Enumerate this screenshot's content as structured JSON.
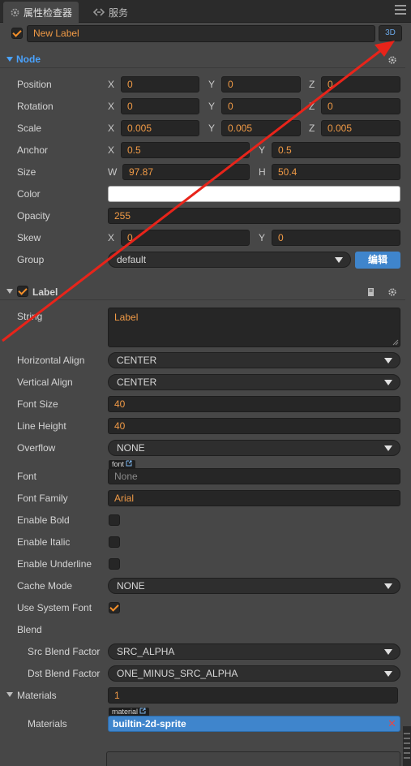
{
  "tabs": [
    {
      "label": "属性检查器",
      "icon": "gear-icon"
    },
    {
      "label": "服务",
      "icon": "link-icon"
    }
  ],
  "node_name": {
    "value": "New Label",
    "toggle": "3D"
  },
  "node_section": {
    "title": "Node",
    "position": {
      "label": "Position",
      "x": "0",
      "y": "0",
      "z": "0"
    },
    "rotation": {
      "label": "Rotation",
      "x": "0",
      "y": "0",
      "z": "0"
    },
    "scale": {
      "label": "Scale",
      "x": "0.005",
      "y": "0.005",
      "z": "0.005"
    },
    "anchor": {
      "label": "Anchor",
      "x": "0.5",
      "y": "0.5"
    },
    "size": {
      "label": "Size",
      "w": "97.87",
      "h": "50.4"
    },
    "color": {
      "label": "Color",
      "value": "#ffffff"
    },
    "opacity": {
      "label": "Opacity",
      "value": "255"
    },
    "skew": {
      "label": "Skew",
      "x": "0",
      "y": "0"
    },
    "group": {
      "label": "Group",
      "value": "default",
      "edit_label": "编辑"
    },
    "axes": {
      "x": "X",
      "y": "Y",
      "z": "Z",
      "w": "W",
      "h": "H"
    }
  },
  "label_section": {
    "title": "Label",
    "string": {
      "label": "String",
      "value": "Label"
    },
    "horizontal_align": {
      "label": "Horizontal Align",
      "value": "CENTER"
    },
    "vertical_align": {
      "label": "Vertical Align",
      "value": "CENTER"
    },
    "font_size": {
      "label": "Font Size",
      "value": "40"
    },
    "line_height": {
      "label": "Line Height",
      "value": "40"
    },
    "overflow": {
      "label": "Overflow",
      "value": "NONE"
    },
    "font": {
      "label": "Font",
      "tag": "font",
      "value": "None"
    },
    "font_family": {
      "label": "Font Family",
      "value": "Arial"
    },
    "enable_bold": {
      "label": "Enable Bold",
      "checked": false
    },
    "enable_italic": {
      "label": "Enable Italic",
      "checked": false
    },
    "enable_underline": {
      "label": "Enable Underline",
      "checked": false
    },
    "cache_mode": {
      "label": "Cache Mode",
      "value": "NONE"
    },
    "use_system_font": {
      "label": "Use System Font",
      "checked": true
    },
    "blend": {
      "label": "Blend"
    },
    "src_blend": {
      "label": "Src Blend Factor",
      "value": "SRC_ALPHA"
    },
    "dst_blend": {
      "label": "Dst Blend Factor",
      "value": "ONE_MINUS_SRC_ALPHA"
    },
    "materials_count": {
      "label": "Materials",
      "value": "1"
    },
    "material": {
      "label": "Materials",
      "tag": "material",
      "value": "builtin-2d-sprite"
    }
  },
  "colors": {
    "accent": "#f09a46",
    "selection": "#3f85cc",
    "annotation_arrow": "#e8241a"
  }
}
